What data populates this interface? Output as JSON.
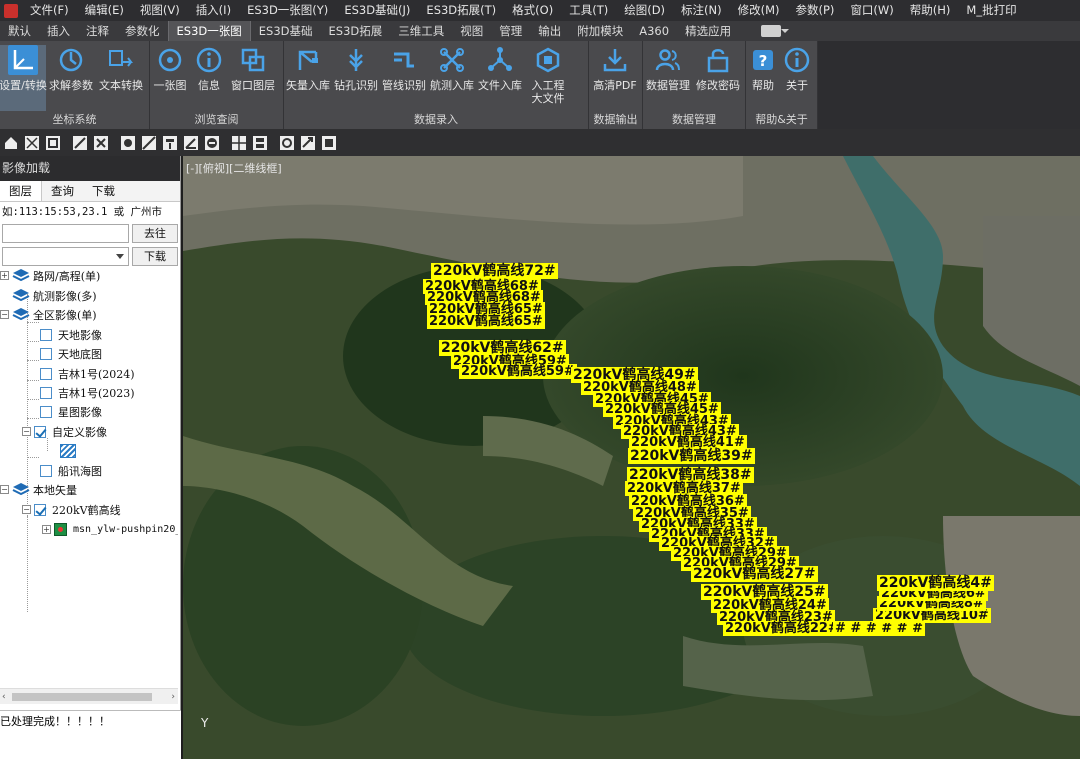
{
  "menubar": {
    "items": [
      "文件(F)",
      "编辑(E)",
      "视图(V)",
      "插入(I)",
      "ES3D一张图(Y)",
      "ES3D基础(J)",
      "ES3D拓展(T)",
      "格式(O)",
      "工具(T)",
      "绘图(D)",
      "标注(N)",
      "修改(M)",
      "参数(P)",
      "窗口(W)",
      "帮助(H)",
      "M_批打印"
    ]
  },
  "ribbon_tabs": {
    "items": [
      "默认",
      "插入",
      "注释",
      "参数化",
      "ES3D一张图",
      "ES3D基础",
      "ES3D拓展",
      "三维工具",
      "视图",
      "管理",
      "输出",
      "附加模块",
      "A360",
      "精选应用"
    ],
    "active": "ES3D一张图"
  },
  "ribbon": {
    "groups": [
      {
        "label": "坐标系统",
        "buttons": [
          "设置/转换",
          "求解参数",
          "文本转换"
        ]
      },
      {
        "label": "浏览查阅",
        "buttons": [
          "一张图",
          "信息",
          "窗口图层"
        ]
      },
      {
        "label": "数据录入",
        "buttons": [
          "矢量入库",
          "钻孔识别",
          "管线识别",
          "航测入库",
          "文件入库",
          "入工程\n大文件"
        ]
      },
      {
        "label": "数据输出",
        "buttons": [
          "高清PDF"
        ]
      },
      {
        "label": "数据管理",
        "buttons": [
          "数据管理",
          "修改密码"
        ]
      },
      {
        "label": "帮助&关于",
        "buttons": [
          "帮助",
          "关于"
        ]
      }
    ]
  },
  "left_panel": {
    "title": "影像加载",
    "tabs": [
      "图层",
      "查询",
      "下载"
    ],
    "coord_text": "如:113:15:53,23.1 或 广州市",
    "goto_label": "去往",
    "download_label": "下载",
    "tree": {
      "road": "路网/高程(单)",
      "aerial": "航测影像(多)",
      "region": "全区影像(单)",
      "tianditu_img": "天地影像",
      "tianditu_base": "天地底图",
      "jilin_2024": "吉林1号(2024)",
      "jilin_2023": "吉林1号(2023)",
      "xingtu": "星图影像",
      "custom": "自定义影像",
      "chart": "船讯海图",
      "local_vector": "本地矢量",
      "line": "220kV鹤高线",
      "pushpin": "msn_ylw-pushpin20_"
    },
    "status_text": "已处理完成！！！！！"
  },
  "viewport": {
    "label": "[-][俯视][二维线框]",
    "y_axis": "Y"
  },
  "map_labels": {
    "l72": "220kV鹤高线72#",
    "l68": "220kV鹤高线68#",
    "l65": "220kV鹤高线65#",
    "l62": "220kV鹤高线62#",
    "l59": "220kV鹤高线59#",
    "l49": "220kV鹤高线49#",
    "l48": "220kV鹤高线48#",
    "l45": "220kV鹤高线45#",
    "l43": "220kV鹤高线43#",
    "l41": "220kV鹤高线41#",
    "l39": "220kV鹤高线39#",
    "l38": "220kV鹤高线38#",
    "l37": "220kV鹤高线37#",
    "l36": "220kV鹤高线36#",
    "l35": "220kV鹤高线35#",
    "l33": "220kV鹤高线33#",
    "l32": "220kV鹤高线32#",
    "l29": "220kV鹤高线29#",
    "l27": "220kV鹤高线27#",
    "l25": "220kV鹤高线25#",
    "l24": "220kV鹤高线24#",
    "l23": "220kV鹤高线23#",
    "l22": "220kV鹤高线22#",
    "l4": "220kV鹤高线4#",
    "l6": "220kV鹤高线6#",
    "l8": "220kV鹤高线8#",
    "l10": "220kV鹤高线10#",
    "hash": "# # # # # #"
  }
}
